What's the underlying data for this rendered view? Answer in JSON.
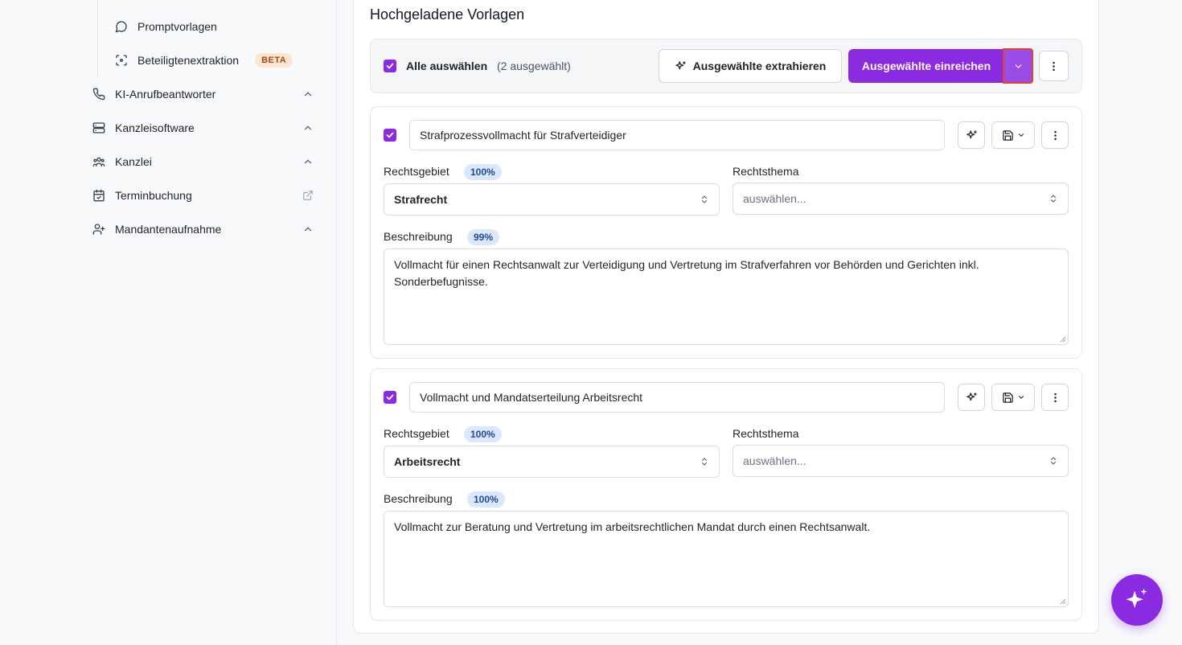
{
  "sidebar": {
    "sub_items": [
      {
        "label": "Promptvorlagen",
        "icon": "message-circle-icon"
      },
      {
        "label": "Beteiligtenextraktion",
        "icon": "scan-face-icon",
        "badge": "BETA"
      }
    ],
    "items": [
      {
        "label": "KI-Anrufbeantworter",
        "icon": "phone-icon",
        "trailing": "chevron-up-icon"
      },
      {
        "label": "Kanzleisoftware",
        "icon": "server-icon",
        "trailing": "chevron-up-icon"
      },
      {
        "label": "Kanzlei",
        "icon": "users-icon",
        "trailing": "chevron-up-icon"
      },
      {
        "label": "Terminbuchung",
        "icon": "calendar-check-icon",
        "trailing": "external-link-icon"
      },
      {
        "label": "Mandantenaufnahme",
        "icon": "user-plus-icon",
        "trailing": "chevron-up-icon"
      }
    ]
  },
  "main": {
    "title": "Hochgeladene Vorlagen",
    "select_bar": {
      "select_all_label": "Alle auswählen",
      "selected_count": "(2 ausgewählt)",
      "extract_button": "Ausgewählte extrahieren",
      "submit_button": "Ausgewählte einreichen"
    },
    "templates": [
      {
        "title": "Strafprozessvollmacht für Strafverteidiger",
        "rechtsgebiet_label": "Rechtsgebiet",
        "rechtsgebiet_pct": "100%",
        "rechtsgebiet_value": "Strafrecht",
        "rechtsthema_label": "Rechtsthema",
        "rechtsthema_placeholder": "auswählen...",
        "beschreibung_label": "Beschreibung",
        "beschreibung_pct": "99%",
        "beschreibung_text": "Vollmacht für einen Rechtsanwalt zur Verteidigung und Vertretung im Strafverfahren vor Behörden und Gerichten inkl. Sonderbefugnisse."
      },
      {
        "title": "Vollmacht und Mandatserteilung Arbeitsrecht",
        "rechtsgebiet_label": "Rechtsgebiet",
        "rechtsgebiet_pct": "100%",
        "rechtsgebiet_value": "Arbeitsrecht",
        "rechtsthema_label": "Rechtsthema",
        "rechtsthema_placeholder": "auswählen...",
        "beschreibung_label": "Beschreibung",
        "beschreibung_pct": "100%",
        "beschreibung_text": "Vollmacht zur Beratung und Vertretung im arbeitsrechtlichen Mandat durch einen Rechtsanwalt."
      }
    ]
  },
  "colors": {
    "accent": "#8a2be2",
    "badge_beta_bg": "#fde7d3",
    "badge_pct_bg": "#dbe8fb",
    "highlight_border": "#e0442b"
  }
}
